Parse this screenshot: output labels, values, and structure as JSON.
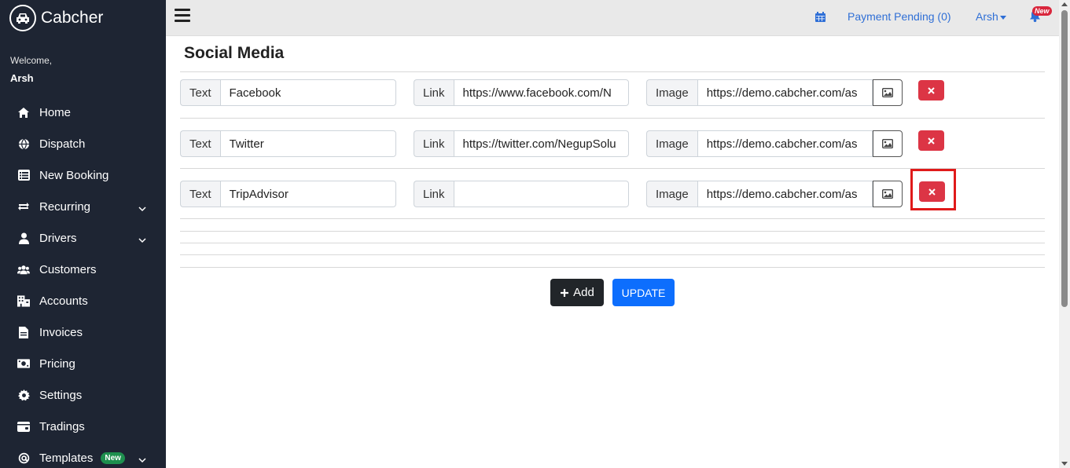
{
  "app": {
    "brand": "Cabcher"
  },
  "sidebar": {
    "welcome": "Welcome,",
    "user": "Arsh",
    "items": [
      {
        "label": "Home",
        "icon": "home-icon"
      },
      {
        "label": "Dispatch",
        "icon": "globe-icon"
      },
      {
        "label": "New Booking",
        "icon": "list-icon"
      },
      {
        "label": "Recurring",
        "icon": "repeat-icon",
        "expandable": true
      },
      {
        "label": "Drivers",
        "icon": "user-icon",
        "expandable": true
      },
      {
        "label": "Customers",
        "icon": "users-icon"
      },
      {
        "label": "Accounts",
        "icon": "building-icon"
      },
      {
        "label": "Invoices",
        "icon": "file-icon"
      },
      {
        "label": "Pricing",
        "icon": "money-icon"
      },
      {
        "label": "Settings",
        "icon": "gear-icon"
      },
      {
        "label": "Tradings",
        "icon": "wallet-icon"
      },
      {
        "label": "Templates",
        "icon": "at-icon",
        "badge": "New",
        "expandable": true
      }
    ]
  },
  "topbar": {
    "payment": "Payment Pending (0)",
    "user": "Arsh",
    "notification_badge": "New"
  },
  "page": {
    "title": "Social Media",
    "text_label": "Text",
    "link_label": "Link",
    "image_label": "Image",
    "rows": [
      {
        "text": "Facebook",
        "link": "https://www.facebook.com/N",
        "image": "https://demo.cabcher.com/as"
      },
      {
        "text": "Twitter",
        "link": "https://twitter.com/NegupSolu",
        "image": "https://demo.cabcher.com/as"
      },
      {
        "text": "TripAdvisor",
        "link": "",
        "image": "https://demo.cabcher.com/as"
      }
    ],
    "add_label": "Add",
    "update_label": "UPDATE"
  },
  "colors": {
    "sidebar": "#1e2533",
    "danger": "#dc3545",
    "primary": "#0d6efd",
    "link": "#2f6fd6"
  }
}
